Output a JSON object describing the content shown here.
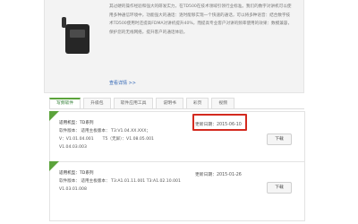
{
  "product": {
    "description": "其过硬的操作经验和强大的研发实力，在TD500在技术领域引领行业标准。我们的数字对讲机可以使用多种通信环境中，功能强大的通话：逐时能够实现一个快速的通话，可以将多种语音：结合数字技术TD500使用时还提高FDMA对讲机提升40%，而提高专业客户对讲的频率使用的效果：数模兼容，保护您的无线网络，提升客户的通话体验。",
    "more_link": "查看详情 >>"
  },
  "tabs": [
    {
      "label": "写频软件",
      "active": true
    },
    {
      "label": "升级包",
      "active": false
    },
    {
      "label": "软件应用工具",
      "active": false
    },
    {
      "label": "说明书",
      "active": false
    },
    {
      "label": "彩页",
      "active": false
    },
    {
      "label": "视频",
      "active": false
    }
  ],
  "downloads": [
    {
      "model": "适用机型：TD系列",
      "firmware": "软件版本：  适用主板版本：  T3:V1.04.XX.XXX；",
      "versions_a": "V：V1.01.04.001",
      "versions_b": "T5（无屏）：V1.08.05.001",
      "version": "V1.04.03.003",
      "date": "更新日期：2015-06-10",
      "button": "下载"
    },
    {
      "model": "适用机型：TD系列",
      "firmware": "软件版本：  适用主板版本：  T3:A1.01.11.001 T3:A1.02.10.001",
      "version": "V1.03.01.008",
      "date": "更新日期：2015-01-26",
      "button": "下载"
    }
  ]
}
